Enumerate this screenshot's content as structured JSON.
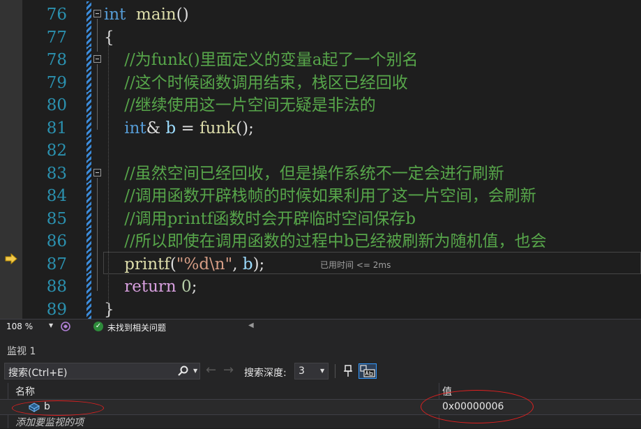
{
  "editor": {
    "lines": [
      {
        "n": "76",
        "code": [
          [
            "kw",
            "int"
          ],
          [
            "",
            "  "
          ],
          [
            "fn",
            "main"
          ],
          [
            "",
            "()"
          ]
        ]
      },
      {
        "n": "77",
        "code": [
          [
            "",
            "{"
          ]
        ]
      },
      {
        "n": "78",
        "code": [
          [
            "",
            "    "
          ],
          [
            "cm",
            "//为funk()里面定义的变量a起了一个别名"
          ]
        ]
      },
      {
        "n": "79",
        "code": [
          [
            "",
            "    "
          ],
          [
            "cm",
            "//这个时候函数调用结束，栈区已经回收"
          ]
        ]
      },
      {
        "n": "80",
        "code": [
          [
            "",
            "    "
          ],
          [
            "cm",
            "//继续使用这一片空间无疑是非法的"
          ]
        ]
      },
      {
        "n": "81",
        "code": [
          [
            "",
            "    "
          ],
          [
            "kw",
            "int"
          ],
          [
            "",
            "& "
          ],
          [
            "var",
            "b"
          ],
          [
            "",
            " = "
          ],
          [
            "fn",
            "funk"
          ],
          [
            "",
            "();"
          ]
        ]
      },
      {
        "n": "82",
        "code": [
          [
            "",
            ""
          ]
        ]
      },
      {
        "n": "83",
        "code": [
          [
            "",
            "    "
          ],
          [
            "cm",
            "//虽然空间已经回收，但是操作系统不一定会进行刷新"
          ]
        ]
      },
      {
        "n": "84",
        "code": [
          [
            "",
            "    "
          ],
          [
            "cm",
            "//调用函数开辟栈帧的时候如果利用了这一片空间，会刷新"
          ]
        ]
      },
      {
        "n": "85",
        "code": [
          [
            "",
            "    "
          ],
          [
            "cm",
            "//调用printf函数时会开辟临时空间保存b"
          ]
        ]
      },
      {
        "n": "86",
        "code": [
          [
            "",
            "    "
          ],
          [
            "cm",
            "//所以即使在调用函数的过程中b已经被刷新为随机值，也会"
          ]
        ]
      },
      {
        "n": "87",
        "code": [
          [
            "",
            "    "
          ],
          [
            "fn",
            "printf"
          ],
          [
            "",
            "("
          ],
          [
            "str",
            "\"%d\\n\""
          ],
          [
            "",
            ", "
          ],
          [
            "var",
            "b"
          ],
          [
            "",
            ");"
          ]
        ]
      },
      {
        "n": "88",
        "code": [
          [
            "",
            "    "
          ],
          [
            "kw2",
            "return"
          ],
          [
            "",
            " "
          ],
          [
            "num",
            "0"
          ],
          [
            "",
            ";"
          ]
        ]
      },
      {
        "n": "89",
        "code": [
          [
            "",
            "}"
          ]
        ]
      }
    ],
    "perf_tip": "已用时间 <= 2ms"
  },
  "status": {
    "zoom": "108 %",
    "issues": "未找到相关问题"
  },
  "watch": {
    "title": "监视 1",
    "search_placeholder": "搜索(Ctrl+E)",
    "depth_label": "搜索深度:",
    "depth_value": "3",
    "col_name": "名称",
    "col_value": "值",
    "rows": [
      {
        "name": "b",
        "value": "0x00000006"
      }
    ],
    "add_item": "添加要监视的项"
  },
  "colors": {
    "highlight": "#e02020",
    "accent": "#3399ff",
    "comment": "#57a64a",
    "keyword": "#569cd6"
  }
}
